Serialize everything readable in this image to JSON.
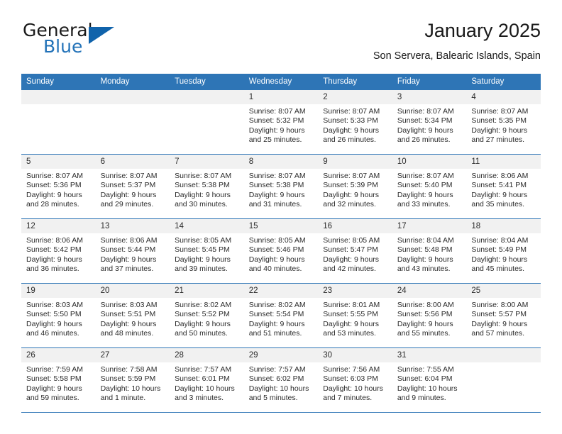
{
  "brand": {
    "word_general": "General",
    "word_blue": "Blue",
    "triangle_color": "#1063ab",
    "blue_text_color": "#2272b8"
  },
  "header": {
    "title": "January 2025",
    "subtitle": "Son Servera, Balearic Islands, Spain"
  },
  "theme": {
    "header_bg": "#2e75b6",
    "header_text": "#ffffff",
    "daynum_bg": "#f1f1f1",
    "row_divider": "#2e75b6"
  },
  "weekday_headers": [
    "Sunday",
    "Monday",
    "Tuesday",
    "Wednesday",
    "Thursday",
    "Friday",
    "Saturday"
  ],
  "labels": {
    "sunrise_prefix": "Sunrise:",
    "sunset_prefix": "Sunset:",
    "daylight_prefix": "Daylight:"
  },
  "weeks": [
    [
      {
        "day": "",
        "empty": true,
        "sunrise": "",
        "sunset": "",
        "daylight_line1": "",
        "daylight_line2": ""
      },
      {
        "day": "",
        "empty": true,
        "sunrise": "",
        "sunset": "",
        "daylight_line1": "",
        "daylight_line2": ""
      },
      {
        "day": "",
        "empty": true,
        "sunrise": "",
        "sunset": "",
        "daylight_line1": "",
        "daylight_line2": ""
      },
      {
        "day": "1",
        "empty": false,
        "sunrise": "Sunrise: 8:07 AM",
        "sunset": "Sunset: 5:32 PM",
        "daylight_line1": "Daylight: 9 hours",
        "daylight_line2": "and 25 minutes."
      },
      {
        "day": "2",
        "empty": false,
        "sunrise": "Sunrise: 8:07 AM",
        "sunset": "Sunset: 5:33 PM",
        "daylight_line1": "Daylight: 9 hours",
        "daylight_line2": "and 26 minutes."
      },
      {
        "day": "3",
        "empty": false,
        "sunrise": "Sunrise: 8:07 AM",
        "sunset": "Sunset: 5:34 PM",
        "daylight_line1": "Daylight: 9 hours",
        "daylight_line2": "and 26 minutes."
      },
      {
        "day": "4",
        "empty": false,
        "sunrise": "Sunrise: 8:07 AM",
        "sunset": "Sunset: 5:35 PM",
        "daylight_line1": "Daylight: 9 hours",
        "daylight_line2": "and 27 minutes."
      }
    ],
    [
      {
        "day": "5",
        "empty": false,
        "sunrise": "Sunrise: 8:07 AM",
        "sunset": "Sunset: 5:36 PM",
        "daylight_line1": "Daylight: 9 hours",
        "daylight_line2": "and 28 minutes."
      },
      {
        "day": "6",
        "empty": false,
        "sunrise": "Sunrise: 8:07 AM",
        "sunset": "Sunset: 5:37 PM",
        "daylight_line1": "Daylight: 9 hours",
        "daylight_line2": "and 29 minutes."
      },
      {
        "day": "7",
        "empty": false,
        "sunrise": "Sunrise: 8:07 AM",
        "sunset": "Sunset: 5:38 PM",
        "daylight_line1": "Daylight: 9 hours",
        "daylight_line2": "and 30 minutes."
      },
      {
        "day": "8",
        "empty": false,
        "sunrise": "Sunrise: 8:07 AM",
        "sunset": "Sunset: 5:38 PM",
        "daylight_line1": "Daylight: 9 hours",
        "daylight_line2": "and 31 minutes."
      },
      {
        "day": "9",
        "empty": false,
        "sunrise": "Sunrise: 8:07 AM",
        "sunset": "Sunset: 5:39 PM",
        "daylight_line1": "Daylight: 9 hours",
        "daylight_line2": "and 32 minutes."
      },
      {
        "day": "10",
        "empty": false,
        "sunrise": "Sunrise: 8:07 AM",
        "sunset": "Sunset: 5:40 PM",
        "daylight_line1": "Daylight: 9 hours",
        "daylight_line2": "and 33 minutes."
      },
      {
        "day": "11",
        "empty": false,
        "sunrise": "Sunrise: 8:06 AM",
        "sunset": "Sunset: 5:41 PM",
        "daylight_line1": "Daylight: 9 hours",
        "daylight_line2": "and 35 minutes."
      }
    ],
    [
      {
        "day": "12",
        "empty": false,
        "sunrise": "Sunrise: 8:06 AM",
        "sunset": "Sunset: 5:42 PM",
        "daylight_line1": "Daylight: 9 hours",
        "daylight_line2": "and 36 minutes."
      },
      {
        "day": "13",
        "empty": false,
        "sunrise": "Sunrise: 8:06 AM",
        "sunset": "Sunset: 5:44 PM",
        "daylight_line1": "Daylight: 9 hours",
        "daylight_line2": "and 37 minutes."
      },
      {
        "day": "14",
        "empty": false,
        "sunrise": "Sunrise: 8:05 AM",
        "sunset": "Sunset: 5:45 PM",
        "daylight_line1": "Daylight: 9 hours",
        "daylight_line2": "and 39 minutes."
      },
      {
        "day": "15",
        "empty": false,
        "sunrise": "Sunrise: 8:05 AM",
        "sunset": "Sunset: 5:46 PM",
        "daylight_line1": "Daylight: 9 hours",
        "daylight_line2": "and 40 minutes."
      },
      {
        "day": "16",
        "empty": false,
        "sunrise": "Sunrise: 8:05 AM",
        "sunset": "Sunset: 5:47 PM",
        "daylight_line1": "Daylight: 9 hours",
        "daylight_line2": "and 42 minutes."
      },
      {
        "day": "17",
        "empty": false,
        "sunrise": "Sunrise: 8:04 AM",
        "sunset": "Sunset: 5:48 PM",
        "daylight_line1": "Daylight: 9 hours",
        "daylight_line2": "and 43 minutes."
      },
      {
        "day": "18",
        "empty": false,
        "sunrise": "Sunrise: 8:04 AM",
        "sunset": "Sunset: 5:49 PM",
        "daylight_line1": "Daylight: 9 hours",
        "daylight_line2": "and 45 minutes."
      }
    ],
    [
      {
        "day": "19",
        "empty": false,
        "sunrise": "Sunrise: 8:03 AM",
        "sunset": "Sunset: 5:50 PM",
        "daylight_line1": "Daylight: 9 hours",
        "daylight_line2": "and 46 minutes."
      },
      {
        "day": "20",
        "empty": false,
        "sunrise": "Sunrise: 8:03 AM",
        "sunset": "Sunset: 5:51 PM",
        "daylight_line1": "Daylight: 9 hours",
        "daylight_line2": "and 48 minutes."
      },
      {
        "day": "21",
        "empty": false,
        "sunrise": "Sunrise: 8:02 AM",
        "sunset": "Sunset: 5:52 PM",
        "daylight_line1": "Daylight: 9 hours",
        "daylight_line2": "and 50 minutes."
      },
      {
        "day": "22",
        "empty": false,
        "sunrise": "Sunrise: 8:02 AM",
        "sunset": "Sunset: 5:54 PM",
        "daylight_line1": "Daylight: 9 hours",
        "daylight_line2": "and 51 minutes."
      },
      {
        "day": "23",
        "empty": false,
        "sunrise": "Sunrise: 8:01 AM",
        "sunset": "Sunset: 5:55 PM",
        "daylight_line1": "Daylight: 9 hours",
        "daylight_line2": "and 53 minutes."
      },
      {
        "day": "24",
        "empty": false,
        "sunrise": "Sunrise: 8:00 AM",
        "sunset": "Sunset: 5:56 PM",
        "daylight_line1": "Daylight: 9 hours",
        "daylight_line2": "and 55 minutes."
      },
      {
        "day": "25",
        "empty": false,
        "sunrise": "Sunrise: 8:00 AM",
        "sunset": "Sunset: 5:57 PM",
        "daylight_line1": "Daylight: 9 hours",
        "daylight_line2": "and 57 minutes."
      }
    ],
    [
      {
        "day": "26",
        "empty": false,
        "sunrise": "Sunrise: 7:59 AM",
        "sunset": "Sunset: 5:58 PM",
        "daylight_line1": "Daylight: 9 hours",
        "daylight_line2": "and 59 minutes."
      },
      {
        "day": "27",
        "empty": false,
        "sunrise": "Sunrise: 7:58 AM",
        "sunset": "Sunset: 5:59 PM",
        "daylight_line1": "Daylight: 10 hours",
        "daylight_line2": "and 1 minute."
      },
      {
        "day": "28",
        "empty": false,
        "sunrise": "Sunrise: 7:57 AM",
        "sunset": "Sunset: 6:01 PM",
        "daylight_line1": "Daylight: 10 hours",
        "daylight_line2": "and 3 minutes."
      },
      {
        "day": "29",
        "empty": false,
        "sunrise": "Sunrise: 7:57 AM",
        "sunset": "Sunset: 6:02 PM",
        "daylight_line1": "Daylight: 10 hours",
        "daylight_line2": "and 5 minutes."
      },
      {
        "day": "30",
        "empty": false,
        "sunrise": "Sunrise: 7:56 AM",
        "sunset": "Sunset: 6:03 PM",
        "daylight_line1": "Daylight: 10 hours",
        "daylight_line2": "and 7 minutes."
      },
      {
        "day": "31",
        "empty": false,
        "sunrise": "Sunrise: 7:55 AM",
        "sunset": "Sunset: 6:04 PM",
        "daylight_line1": "Daylight: 10 hours",
        "daylight_line2": "and 9 minutes."
      },
      {
        "day": "",
        "empty": true,
        "sunrise": "",
        "sunset": "",
        "daylight_line1": "",
        "daylight_line2": ""
      }
    ]
  ]
}
